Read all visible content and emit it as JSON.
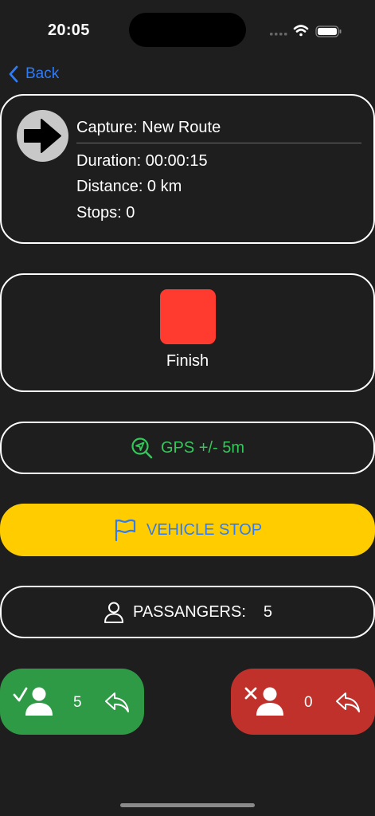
{
  "status_bar": {
    "time": "20:05"
  },
  "nav": {
    "back_label": "Back"
  },
  "capture": {
    "title": "Capture: New Route",
    "duration": "Duration: 00:00:15",
    "distance": "Distance: 0 km",
    "stops": "Stops: 0"
  },
  "finish": {
    "label": "Finish"
  },
  "gps": {
    "label": "GPS +/- 5m"
  },
  "vehicle_stop": {
    "label": "VEHICLE STOP"
  },
  "passengers": {
    "label": "PASSANGERS:",
    "count": "5"
  },
  "boarding": {
    "count": "5"
  },
  "alighting": {
    "count": "0"
  },
  "colors": {
    "background": "#1e1e1e",
    "accent_blue": "#2f7cf6",
    "stop_red": "#ff3b30",
    "gps_green": "#34c759",
    "vehicle_yellow": "#ffcc00",
    "board_green": "#2e9a45",
    "alight_red": "#c0312b"
  },
  "icons": {
    "back": "chevron-left-icon",
    "route": "arrow-right-icon",
    "gps": "location-search-icon",
    "vehicle_stop": "flag-icon",
    "passengers": "person-icon",
    "board": "person-check-icon",
    "alight": "person-x-icon",
    "undo": "undo-arrow-icon"
  }
}
